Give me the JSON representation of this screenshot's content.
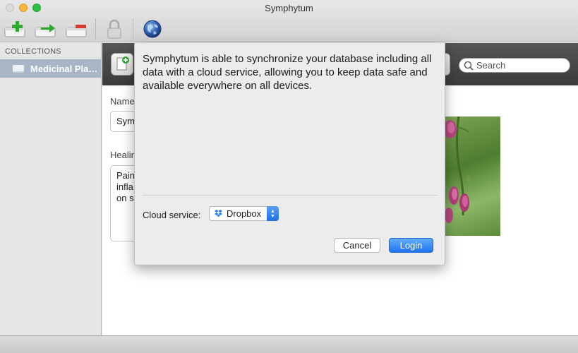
{
  "window": {
    "title": "Symphytum"
  },
  "toolbar": {
    "icons": [
      "add-collection-icon",
      "duplicate-collection-icon",
      "delete-collection-icon",
      "lock-icon",
      "globe-icon"
    ]
  },
  "sidebar": {
    "header": "COLLECTIONS",
    "items": [
      {
        "label": "Medicinal Plan..."
      }
    ]
  },
  "search": {
    "placeholder": "Search"
  },
  "form": {
    "name_label": "Name",
    "name_value": "Sym",
    "healing_label": "Healin",
    "healing_value": "Pain\ninfla\non s"
  },
  "dialog": {
    "message": "Symphytum is able to synchronize your database including all data with a cloud service, allowing you to keep data safe and available everywhere on all devices.",
    "cloud_service_label": "Cloud service:",
    "cloud_service_value": "Dropbox",
    "cancel_label": "Cancel",
    "login_label": "Login"
  },
  "colors": {
    "accent": "#1d74ee",
    "sidebar_selection": "#a9b6c7",
    "header_dark": "#444444"
  }
}
